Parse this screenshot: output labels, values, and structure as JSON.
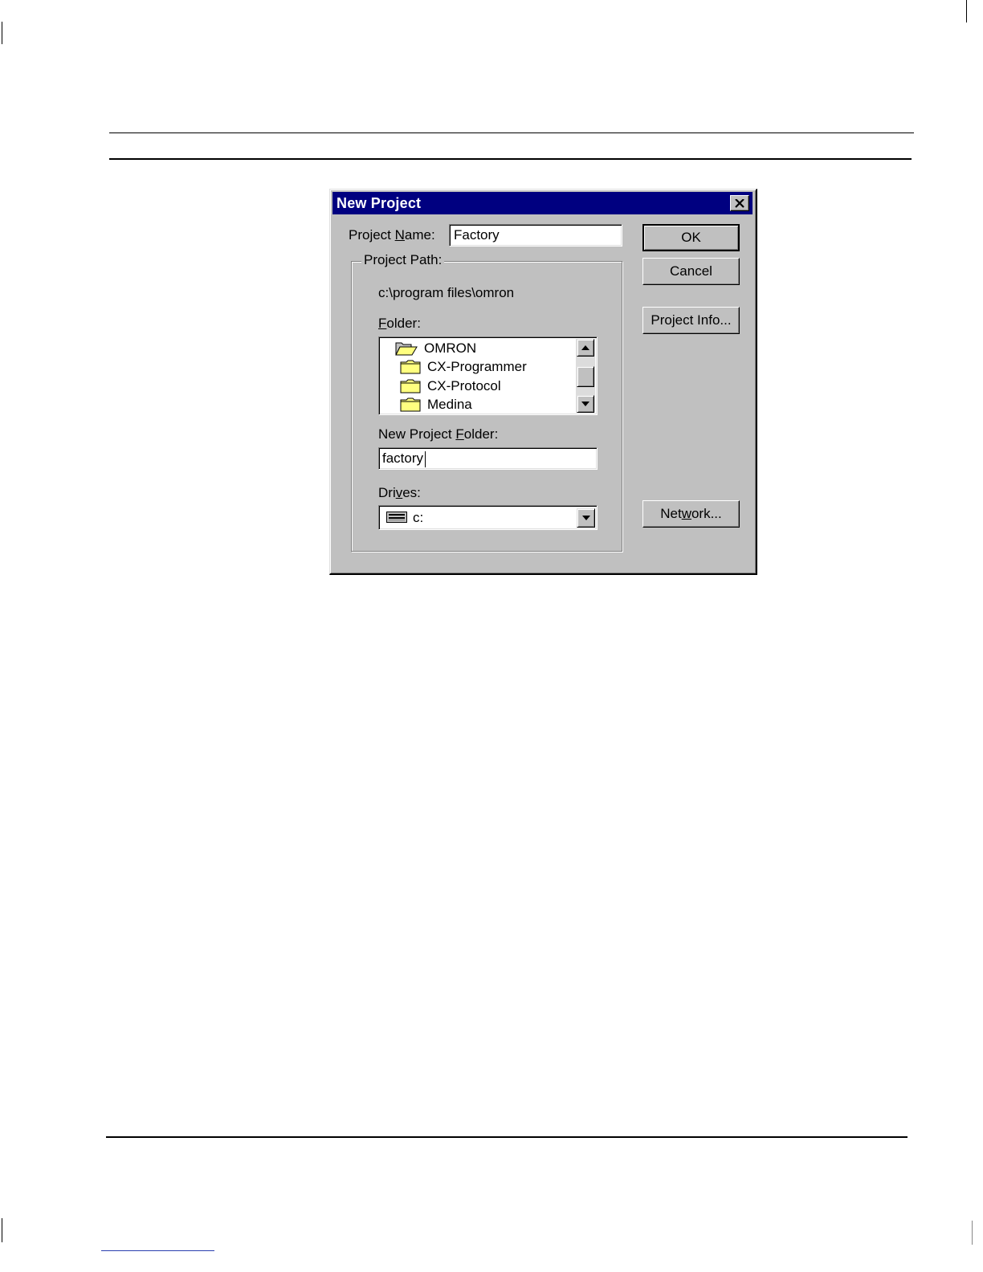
{
  "dialog": {
    "title": "New Project",
    "project_name_label_pre": "Project ",
    "project_name_label_key": "N",
    "project_name_label_post": "ame:",
    "project_name_value": "Factory",
    "project_path_legend": "Project Path:",
    "current_path": "c:\\program files\\omron",
    "folder_label_key": "F",
    "folder_label_post": "older:",
    "folders": [
      {
        "label": "OMRON",
        "icon": "open-folder-icon"
      },
      {
        "label": "CX-Programmer",
        "icon": "folder-icon"
      },
      {
        "label": "CX-Protocol",
        "icon": "folder-icon"
      },
      {
        "label": "Medina",
        "icon": "folder-icon"
      }
    ],
    "new_folder_label_pre": "New Project ",
    "new_folder_label_key": "F",
    "new_folder_label_post": "older:",
    "new_folder_value": "factory",
    "drives_label_pre": "Dri",
    "drives_label_key": "v",
    "drives_label_post": "es:",
    "drive_value": "c:",
    "buttons": {
      "ok": "OK",
      "cancel": "Cancel",
      "project_info": "Project Info...",
      "network_pre": "Net",
      "network_key": "w",
      "network_post": "ork..."
    }
  },
  "colors": {
    "titlebar": "#000080",
    "dialog_face": "#c0c0c0",
    "folder_yellow": "#ffff80"
  }
}
